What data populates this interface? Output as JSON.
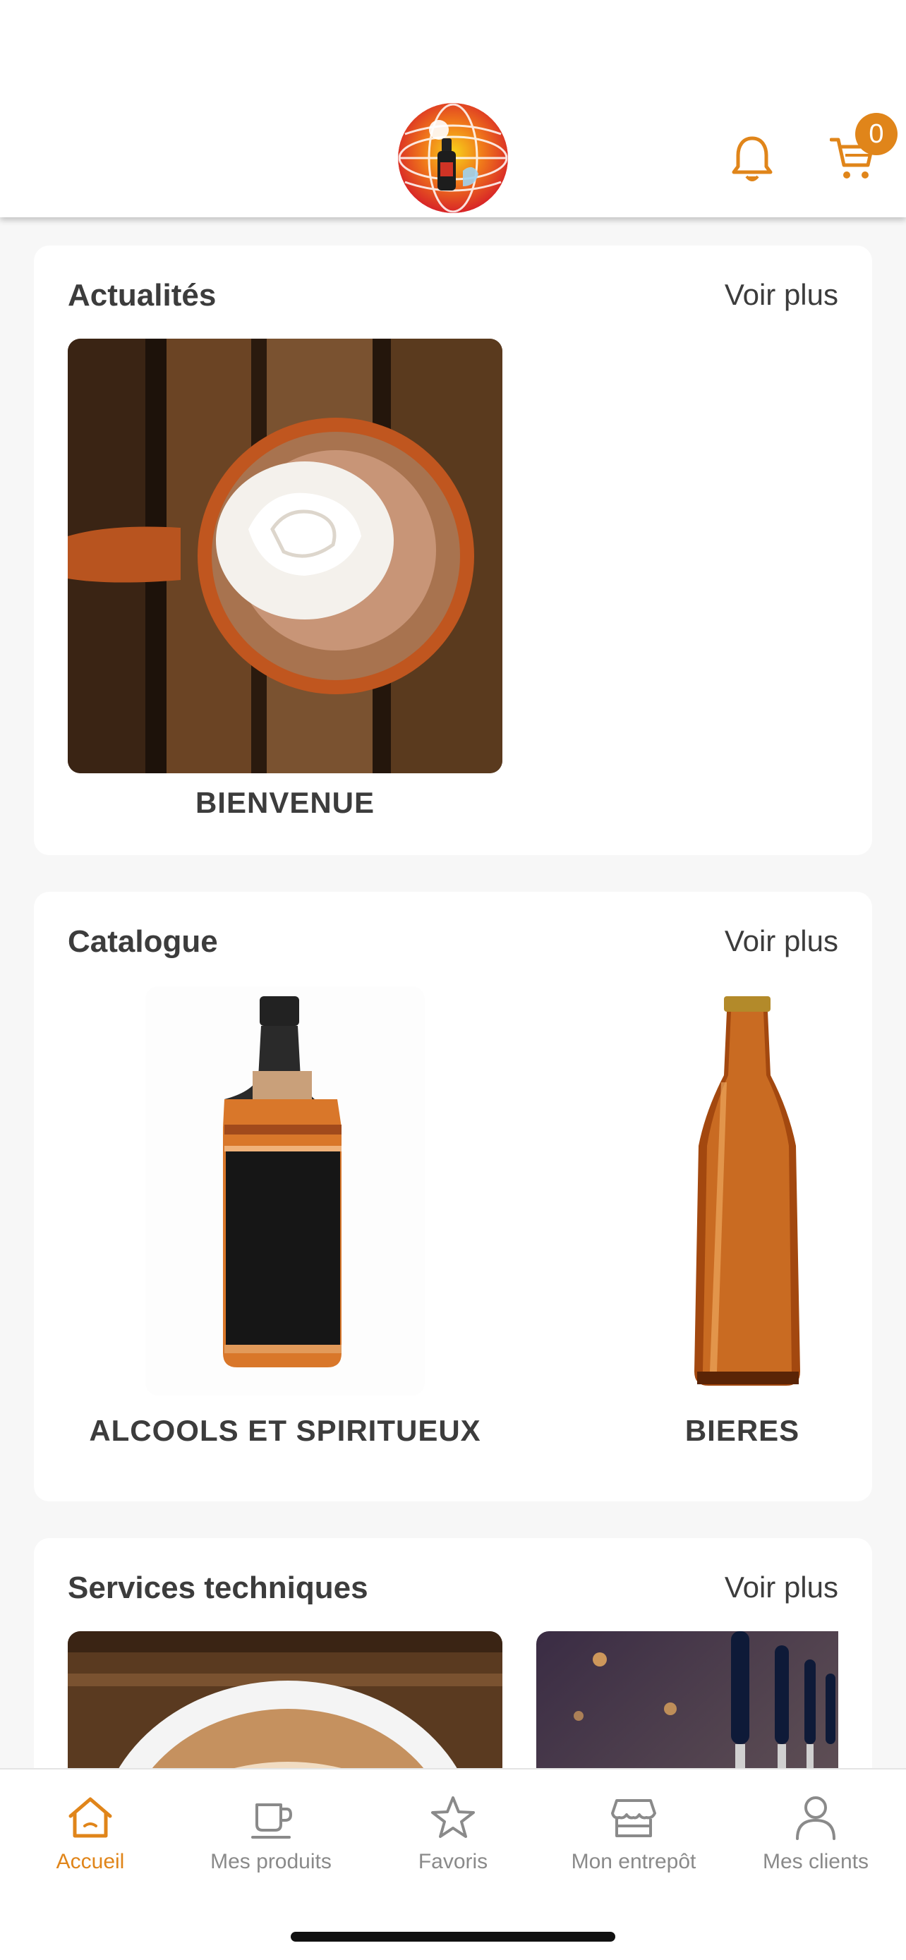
{
  "colors": {
    "accent": "#e0851a",
    "inactive": "#8a8a8a",
    "text": "#3c3c3c"
  },
  "header": {
    "logo_icon": "globe-bottle-logo",
    "bell_icon": "bell-icon",
    "cart_icon": "cart-icon",
    "cart_count": "0"
  },
  "sections": {
    "news": {
      "title": "Actualités",
      "more": "Voir plus",
      "items": [
        {
          "label": "BIENVENUE",
          "image": "hot-chocolate-whipped-cream"
        }
      ]
    },
    "catalogue": {
      "title": "Catalogue",
      "more": "Voir plus",
      "items": [
        {
          "label": "ALCOOLS ET SPIRITUEUX",
          "image": "whiskey-bottle"
        },
        {
          "label": "BIERES",
          "image": "beer-bottle"
        }
      ]
    },
    "services": {
      "title": "Services techniques",
      "more": "Voir plus",
      "items": [
        {
          "image": "coffee-latte"
        },
        {
          "image": "beer-taps"
        }
      ]
    }
  },
  "nav": [
    {
      "label": "Accueil",
      "icon": "home-icon",
      "active": true
    },
    {
      "label": "Mes produits",
      "icon": "cup-icon",
      "active": false
    },
    {
      "label": "Favoris",
      "icon": "star-icon",
      "active": false
    },
    {
      "label": "Mon entrepôt",
      "icon": "store-icon",
      "active": false
    },
    {
      "label": "Mes clients",
      "icon": "user-icon",
      "active": false
    }
  ]
}
